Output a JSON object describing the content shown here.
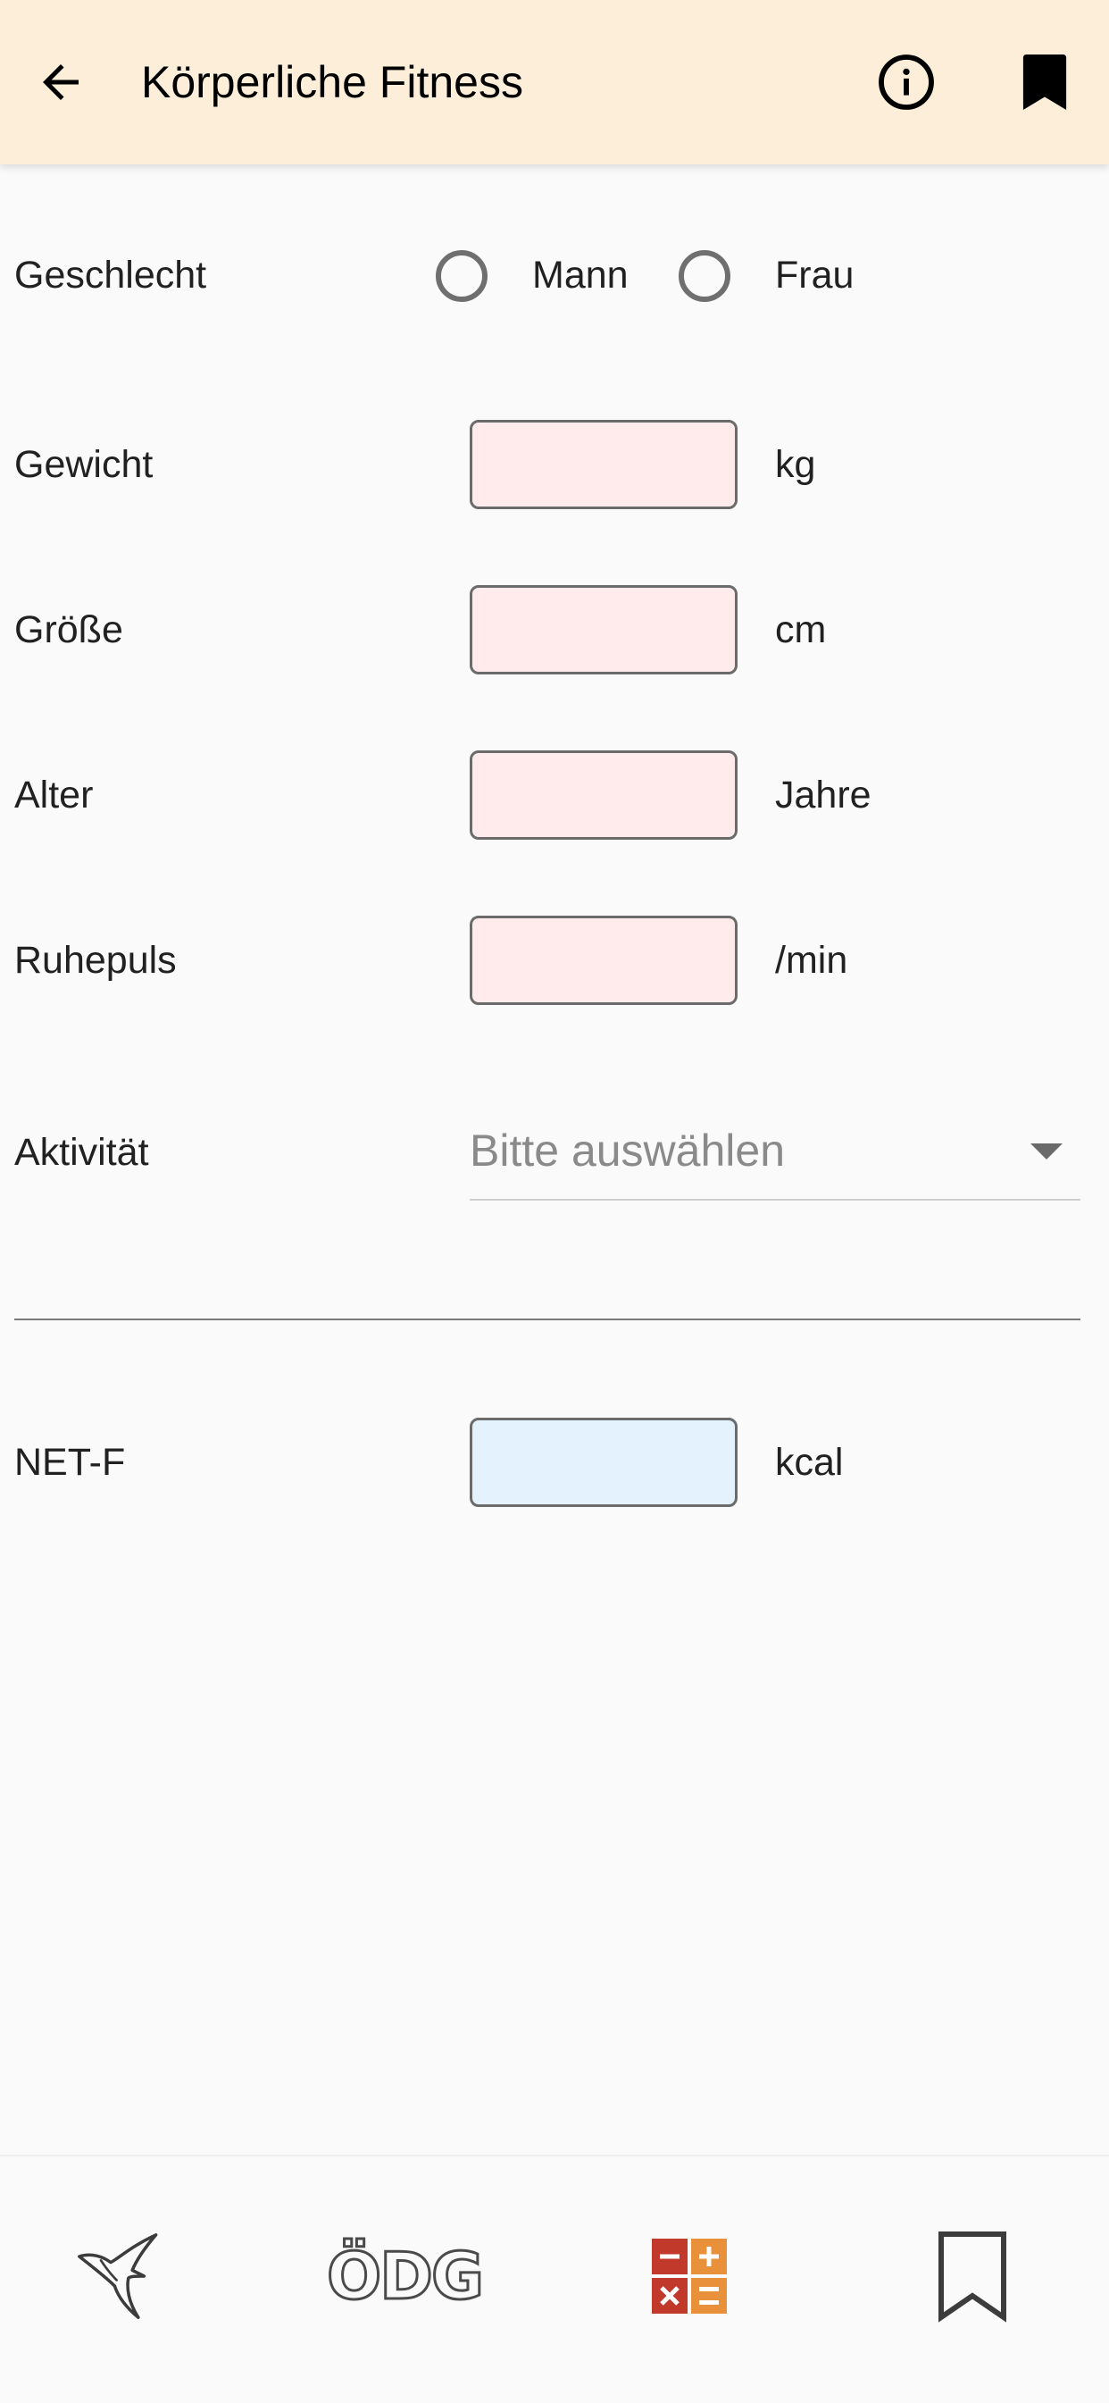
{
  "app_bar": {
    "title": "Körperliche Fitness",
    "back_icon": "arrow-back-icon",
    "info_icon": "info-icon",
    "bookmark_icon": "bookmark-icon",
    "background": "#fdeed9"
  },
  "form": {
    "gender": {
      "label": "Geschlecht",
      "options": [
        {
          "label": "Mann",
          "selected": false
        },
        {
          "label": "Frau",
          "selected": false
        }
      ]
    },
    "weight": {
      "label": "Gewicht",
      "value": "",
      "unit": "kg"
    },
    "height": {
      "label": "Größe",
      "value": "",
      "unit": "cm"
    },
    "age": {
      "label": "Alter",
      "value": "",
      "unit": "Jahre"
    },
    "resting_pulse": {
      "label": "Ruhepuls",
      "value": "",
      "unit": "/min"
    },
    "activity": {
      "label": "Aktivität",
      "placeholder": "Bitte auswählen"
    },
    "result": {
      "label": "NET-F",
      "value": "",
      "unit": "kcal"
    }
  },
  "colors": {
    "input_bg": "#ffeaec",
    "result_bg": "#e4f2fd",
    "calc_red": "#c0392b",
    "calc_orange": "#e8913a"
  },
  "bottom_nav": {
    "items": [
      {
        "icon": "hummingbird-icon"
      },
      {
        "text": "ÖDG"
      },
      {
        "icon": "calculator-icon"
      },
      {
        "icon": "bookmark-outline-icon"
      }
    ]
  }
}
